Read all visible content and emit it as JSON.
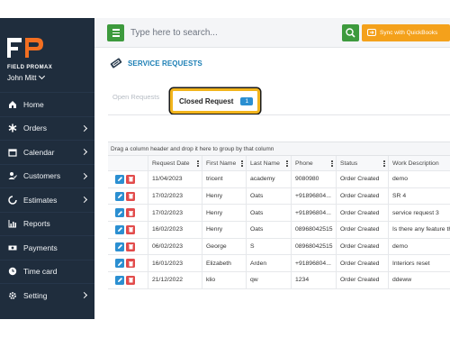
{
  "brand": {
    "logo_text": "FP",
    "sub": "FIELD PROMAX"
  },
  "user": {
    "name": "John Mitt"
  },
  "sidebar": {
    "items": [
      {
        "label": "Home",
        "icon": "home-icon",
        "arrow": false
      },
      {
        "label": "Orders",
        "icon": "asterisk-icon",
        "arrow": true
      },
      {
        "label": "Calendar",
        "icon": "calendar-icon",
        "arrow": true
      },
      {
        "label": "Customers",
        "icon": "users-icon",
        "arrow": true
      },
      {
        "label": "Estimates",
        "icon": "circle-notch-icon",
        "arrow": true
      },
      {
        "label": "Reports",
        "icon": "chart-icon",
        "arrow": false
      },
      {
        "label": "Payments",
        "icon": "money-icon",
        "arrow": false
      },
      {
        "label": "Time card",
        "icon": "clock-icon",
        "arrow": false
      },
      {
        "label": "Setting",
        "icon": "gear-icon",
        "arrow": true
      }
    ]
  },
  "topbar": {
    "search_placeholder": "Type here to search...",
    "sync_label": "Sync with QuickBooks"
  },
  "page": {
    "title": "SERVICE REQUESTS",
    "tabs": {
      "open": "Open Requests",
      "closed": "Closed Request",
      "closed_count": "1"
    },
    "group_hint": "Drag a column header and drop it here to group by that column"
  },
  "grid": {
    "columns": [
      "Request Date",
      "First Name",
      "Last Name",
      "Phone",
      "Status",
      "Work Description"
    ],
    "rows": [
      {
        "date": "11/04/2023",
        "first": "tricent",
        "last": "academy",
        "phone": "9080980",
        "status": "Order Created",
        "desc": "demo"
      },
      {
        "date": "17/02/2023",
        "first": "Henry",
        "last": "Oats",
        "phone": "+91896804...",
        "status": "Order Created",
        "desc": "SR 4"
      },
      {
        "date": "17/02/2023",
        "first": "Henry",
        "last": "Oats",
        "phone": "+91896804...",
        "status": "Order Created",
        "desc": "service request 3"
      },
      {
        "date": "16/02/2023",
        "first": "Henry",
        "last": "Oats",
        "phone": "08968042515",
        "status": "Order Created",
        "desc": "Is there any feature tha"
      },
      {
        "date": "06/02/2023",
        "first": "George",
        "last": "S",
        "phone": "08968042515",
        "status": "Order Created",
        "desc": "demo"
      },
      {
        "date": "16/01/2023",
        "first": "Elizabeth",
        "last": "Arden",
        "phone": "+91896804...",
        "status": "Order Created",
        "desc": "Interiors reset"
      },
      {
        "date": "21/12/2022",
        "first": "klio",
        "last": "qw",
        "phone": "1234",
        "status": "Order Created",
        "desc": "ddeww"
      }
    ]
  }
}
